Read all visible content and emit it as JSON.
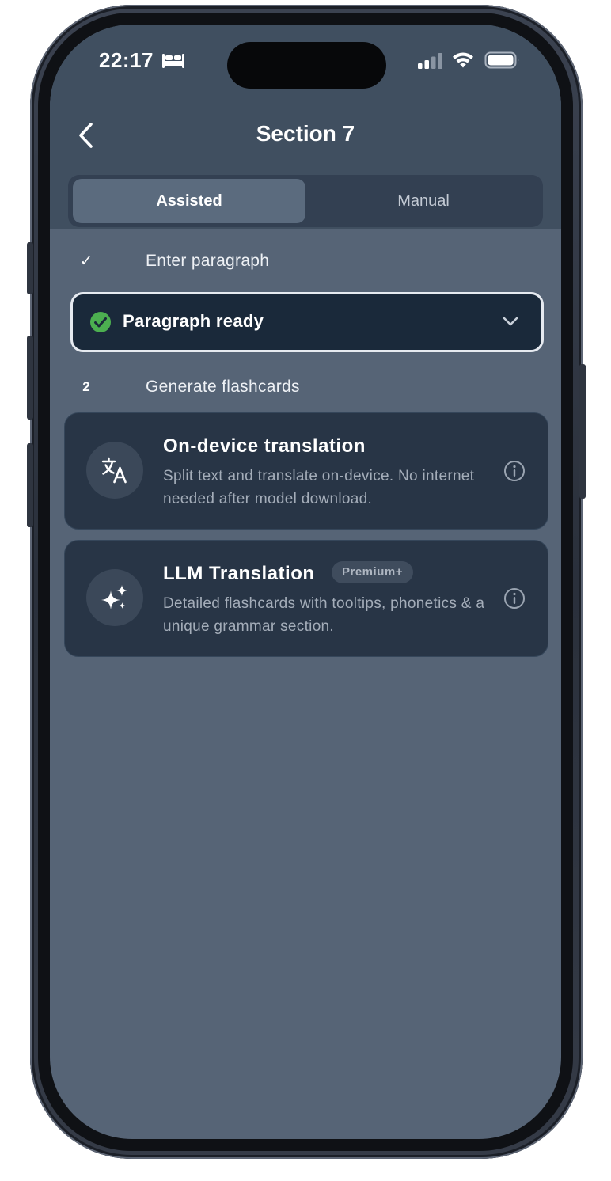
{
  "status_bar": {
    "time": "22:17",
    "focus_icon": "bed-icon",
    "signal_icon": "cellular-signal-icon",
    "wifi_icon": "wifi-icon",
    "battery_icon": "battery-icon"
  },
  "nav": {
    "back_icon": "chevron-left-icon",
    "title": "Section 7"
  },
  "mode_tabs": [
    {
      "label": "Assisted",
      "selected": true
    },
    {
      "label": "Manual",
      "selected": false
    }
  ],
  "steps": {
    "step1": {
      "marker": "✓",
      "label": "Enter paragraph"
    },
    "paragraph_status": {
      "label": "Paragraph ready",
      "status_icon": "check-circle-icon",
      "chevron_icon": "chevron-down-icon",
      "status_color": "#4caf50"
    },
    "step2": {
      "marker": "2",
      "label": "Generate flashcards"
    }
  },
  "options": [
    {
      "title": "On-device translation",
      "description": "Split text and translate on-device. No internet needed after model download.",
      "icon": "translate-icon",
      "info_icon": "info-icon"
    },
    {
      "title": "LLM Translation",
      "badge": "Premium+",
      "description": "Detailed flashcards with tooltips, phonetics & a unique grammar section.",
      "icon": "sparkles-icon",
      "info_icon": "info-icon"
    }
  ],
  "colors": {
    "screen_bg": "#566476",
    "header_bg": "#404f60",
    "card_bg": "#283546",
    "pill_bg": "#1a293a",
    "success": "#4caf50"
  }
}
